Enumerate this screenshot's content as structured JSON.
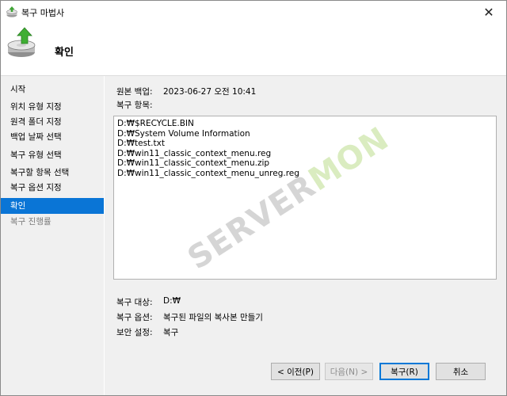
{
  "window": {
    "title": "복구 마법사",
    "close_glyph": "✕"
  },
  "header": {
    "title": "확인"
  },
  "sidebar": {
    "items": [
      {
        "label": "시작",
        "state": "normal"
      },
      {
        "label": "위치 유형 지정",
        "state": "normal"
      },
      {
        "label": "원격 폴더 지정",
        "state": "normal"
      },
      {
        "label": "백업 날짜 선택",
        "state": "normal"
      },
      {
        "label": "복구 유형 선택",
        "state": "normal"
      },
      {
        "label": "복구할 항목 선택",
        "state": "normal"
      },
      {
        "label": "복구 옵션 지정",
        "state": "normal"
      },
      {
        "label": "확인",
        "state": "active"
      },
      {
        "label": "복구 진행률",
        "state": "disabled"
      }
    ]
  },
  "main": {
    "source_label": "원본 백업:",
    "source_value": "2023-06-27 오전 10:41",
    "items_label": "복구 항목:",
    "items": [
      "D:₩$RECYCLE.BIN",
      "D:₩System Volume Information",
      "D:₩test.txt",
      "D:₩win11_classic_context_menu.reg",
      "D:₩win11_classic_context_menu.zip",
      "D:₩win11_classic_context_menu_unreg.reg"
    ],
    "target_label": "복구 대상:",
    "target_value": "D:₩",
    "options_label": "복구 옵션:",
    "options_value": "복구된 파일의 복사본 만들기",
    "security_label": "보안 설정:",
    "security_value": "복구"
  },
  "buttons": {
    "back": "< 이전(P)",
    "next": "다음(N) >",
    "recover": "복구(R)",
    "cancel": "취소"
  },
  "watermark": {
    "part1": "SERVER",
    "part2": "MON"
  },
  "colors": {
    "accent": "#0a75d6",
    "sidebar_bg": "#f0f0f0",
    "watermark_green": "#8dc53e"
  }
}
